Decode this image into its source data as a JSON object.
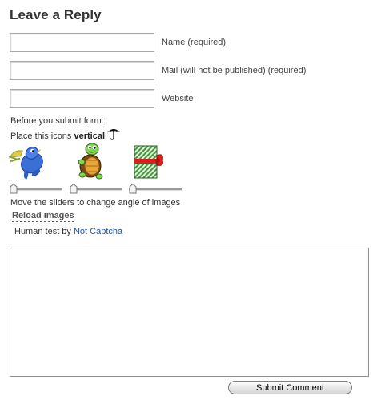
{
  "form": {
    "title": "Leave a Reply",
    "fields": [
      {
        "label": "Name (required)",
        "value": "",
        "placeholder": ""
      },
      {
        "label": "Mail (will not be published) (required)",
        "value": "",
        "placeholder": ""
      },
      {
        "label": "Website",
        "value": "",
        "placeholder": ""
      }
    ],
    "before_submit": "Before you submit form:",
    "instruction_prefix": "Place this icons ",
    "instruction_emphasis": "vertical",
    "captcha_icons": [
      "bird-icon",
      "turtle-icon",
      "gift-icon"
    ],
    "hint_icon": "umbrella-icon",
    "slider_hint": "Move the sliders to change angle of images",
    "reload_label": "Reload images",
    "human_test_prefix": "Human test by ",
    "human_test_link": "Not Captcha",
    "comment_value": "",
    "submit_label": "Submit Comment",
    "colors": {
      "link": "#1a52b3",
      "title": "#333333"
    }
  }
}
